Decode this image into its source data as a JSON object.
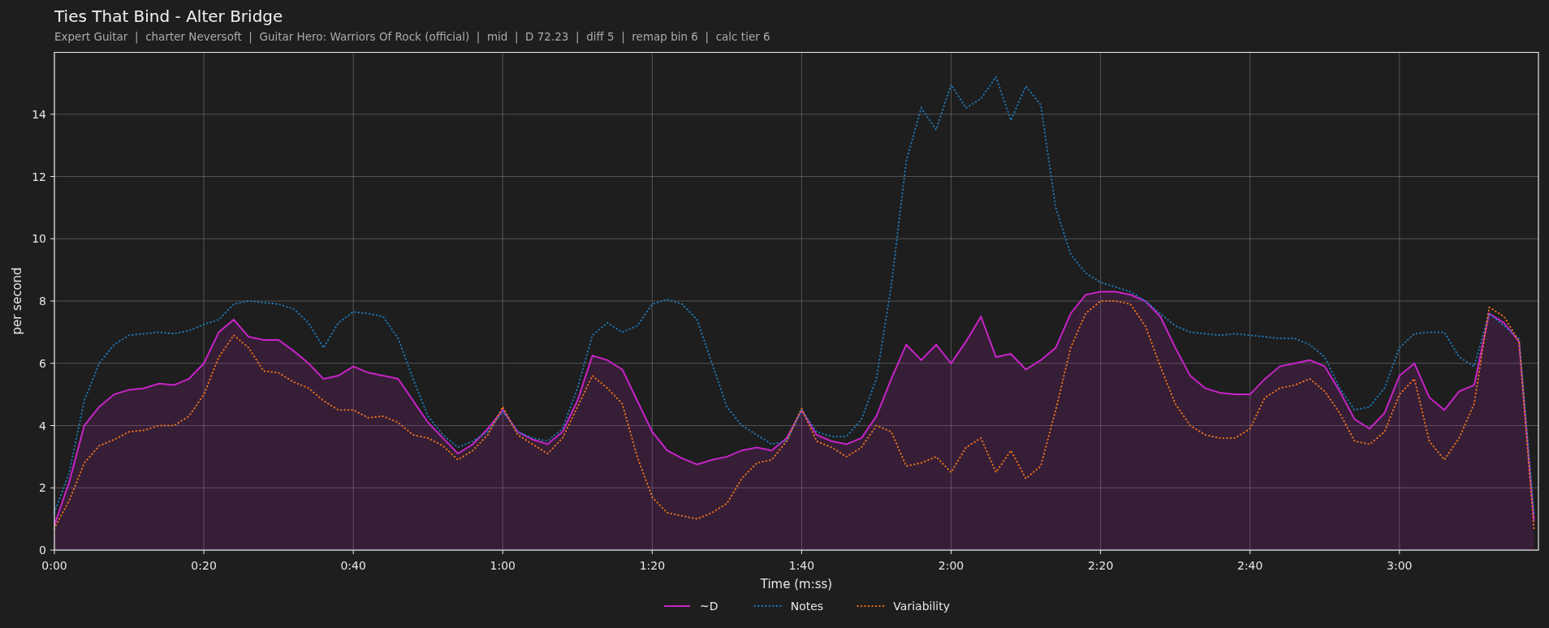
{
  "header": {
    "title": "Ties That Bind - Alter Bridge",
    "subtitle": "Expert Guitar  |  charter Neversoft  |  Guitar Hero: Warriors Of Rock (official)  |  mid  |  D 72.23  |  diff 5  |  remap bin 6  |  calc tier 6"
  },
  "chart_data": {
    "type": "line",
    "xlabel": "Time (m:ss)",
    "ylabel": "per second",
    "x": [
      0,
      2,
      4,
      6,
      8,
      10,
      12,
      14,
      16,
      18,
      20,
      22,
      24,
      26,
      28,
      30,
      32,
      34,
      36,
      38,
      40,
      42,
      44,
      46,
      48,
      50,
      52,
      54,
      56,
      58,
      60,
      62,
      64,
      66,
      68,
      70,
      72,
      74,
      76,
      78,
      80,
      82,
      84,
      86,
      88,
      90,
      92,
      94,
      96,
      98,
      100,
      102,
      104,
      106,
      108,
      110,
      112,
      114,
      116,
      118,
      120,
      122,
      124,
      126,
      128,
      130,
      132,
      134,
      136,
      138,
      140,
      142,
      144,
      146,
      148,
      150,
      152,
      154,
      156,
      158,
      160,
      162,
      164,
      166,
      168,
      170,
      172,
      174,
      176,
      178,
      180,
      182,
      184,
      186,
      188,
      190,
      192,
      194,
      196,
      198
    ],
    "series": [
      {
        "name": "~D",
        "color": "#c724c7",
        "line_style": "solid",
        "values": [
          0.8,
          2.2,
          4.0,
          4.6,
          5.0,
          5.15,
          5.2,
          5.35,
          5.3,
          5.5,
          6.0,
          7.0,
          7.4,
          6.85,
          6.75,
          6.75,
          6.4,
          6.0,
          5.5,
          5.6,
          5.9,
          5.7,
          5.6,
          5.5,
          4.8,
          4.1,
          3.6,
          3.1,
          3.4,
          3.9,
          4.5,
          3.8,
          3.55,
          3.4,
          3.8,
          4.8,
          6.25,
          6.1,
          5.8,
          4.8,
          3.8,
          3.2,
          2.95,
          2.75,
          2.9,
          3.0,
          3.2,
          3.3,
          3.2,
          3.6,
          4.5,
          3.7,
          3.5,
          3.4,
          3.6,
          4.3,
          5.5,
          6.6,
          6.1,
          6.6,
          6.0,
          6.7,
          7.5,
          6.2,
          6.3,
          5.8,
          6.1,
          6.5,
          7.6,
          8.2,
          8.3,
          8.3,
          8.2,
          8.0,
          7.5,
          6.5,
          5.6,
          5.2,
          5.05,
          5.0,
          5.0,
          5.5,
          5.9,
          6.0,
          6.1,
          5.9,
          5.1,
          4.2,
          3.9,
          4.4,
          5.6,
          6.0,
          4.9,
          4.5,
          5.1,
          5.3,
          7.6,
          7.3,
          6.7,
          0.95
        ]
      },
      {
        "name": "Notes",
        "color": "#1f77b4",
        "line_style": "dotted",
        "values": [
          1.2,
          2.5,
          4.8,
          6.0,
          6.6,
          6.9,
          6.95,
          7.0,
          6.95,
          7.05,
          7.25,
          7.4,
          7.9,
          8.0,
          7.95,
          7.9,
          7.75,
          7.3,
          6.5,
          7.3,
          7.65,
          7.6,
          7.5,
          6.8,
          5.5,
          4.3,
          3.7,
          3.3,
          3.5,
          3.8,
          4.45,
          3.8,
          3.6,
          3.5,
          3.9,
          5.2,
          6.9,
          7.3,
          7.0,
          7.2,
          7.9,
          8.05,
          7.9,
          7.4,
          6.0,
          4.6,
          4.0,
          3.7,
          3.4,
          3.5,
          4.5,
          3.8,
          3.65,
          3.65,
          4.2,
          5.5,
          8.5,
          12.5,
          14.2,
          13.5,
          14.95,
          14.2,
          14.5,
          15.2,
          13.8,
          14.9,
          14.3,
          11.0,
          9.5,
          8.9,
          8.6,
          8.45,
          8.3,
          8.0,
          7.6,
          7.2,
          7.0,
          6.95,
          6.9,
          6.95,
          6.9,
          6.85,
          6.8,
          6.8,
          6.6,
          6.2,
          5.2,
          4.5,
          4.6,
          5.2,
          6.5,
          6.95,
          7.0,
          7.0,
          6.2,
          5.9,
          7.6,
          7.2,
          6.8,
          1.2
        ]
      },
      {
        "name": "Variability",
        "color": "#e8731c",
        "line_style": "dotted",
        "values": [
          0.7,
          1.6,
          2.8,
          3.35,
          3.55,
          3.8,
          3.85,
          4.0,
          4.0,
          4.3,
          5.0,
          6.2,
          6.9,
          6.5,
          5.75,
          5.7,
          5.4,
          5.2,
          4.8,
          4.5,
          4.5,
          4.25,
          4.3,
          4.1,
          3.7,
          3.6,
          3.35,
          2.9,
          3.2,
          3.7,
          4.6,
          3.7,
          3.4,
          3.1,
          3.6,
          4.6,
          5.6,
          5.2,
          4.7,
          3.0,
          1.7,
          1.2,
          1.1,
          1.0,
          1.2,
          1.5,
          2.3,
          2.8,
          2.9,
          3.5,
          4.55,
          3.5,
          3.3,
          3.0,
          3.3,
          4.0,
          3.8,
          2.7,
          2.8,
          3.0,
          2.5,
          3.3,
          3.6,
          2.5,
          3.2,
          2.3,
          2.7,
          4.5,
          6.5,
          7.6,
          8.0,
          8.0,
          7.9,
          7.2,
          5.9,
          4.7,
          4.0,
          3.7,
          3.6,
          3.6,
          3.9,
          4.9,
          5.2,
          5.3,
          5.5,
          5.1,
          4.4,
          3.5,
          3.4,
          3.8,
          5.0,
          5.5,
          3.5,
          2.9,
          3.6,
          4.7,
          7.8,
          7.5,
          6.7,
          0.7
        ]
      }
    ],
    "xlim": [
      0,
      198.6
    ],
    "ylim": [
      0,
      16
    ],
    "grid": true,
    "legend": true,
    "xticks": [
      {
        "value": 0,
        "label": "0:00"
      },
      {
        "value": 20,
        "label": "0:20"
      },
      {
        "value": 40,
        "label": "0:40"
      },
      {
        "value": 60,
        "label": "1:00"
      },
      {
        "value": 80,
        "label": "1:20"
      },
      {
        "value": 100,
        "label": "1:40"
      },
      {
        "value": 120,
        "label": "2:00"
      },
      {
        "value": 140,
        "label": "2:20"
      },
      {
        "value": 160,
        "label": "2:40"
      },
      {
        "value": 180,
        "label": "3:00"
      }
    ],
    "yticks": [
      0,
      2,
      4,
      6,
      8,
      10,
      12,
      14
    ]
  }
}
